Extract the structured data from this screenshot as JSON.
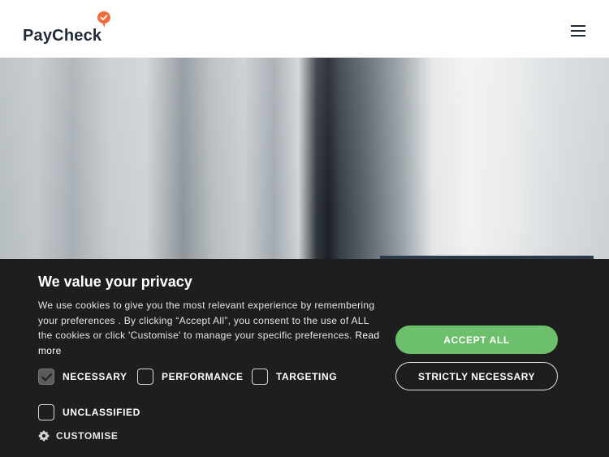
{
  "header": {
    "logo_text": "PayCheck",
    "logo_mark_color": "#f26b3a",
    "menu_icon": "hamburger-menu-icon"
  },
  "cookie_banner": {
    "title": "We value your privacy",
    "description": "We use cookies to give you the most relevant experience by remembering your preferences . By clicking “Accept All”, you consent to the use of ALL the cookies or click 'Customise' to manage your specific preferences.",
    "read_more": "Read more",
    "checkboxes": [
      {
        "label": "NECESSARY",
        "checked": true
      },
      {
        "label": "PERFORMANCE",
        "checked": false
      },
      {
        "label": "TARGETING",
        "checked": false
      },
      {
        "label": "UNCLASSIFIED",
        "checked": false
      }
    ],
    "customise_label": "CUSTOMISE",
    "customise_icon": "gear-icon",
    "accept_all_label": "ACCEPT ALL",
    "strictly_necessary_label": "STRICTLY NECESSARY",
    "colors": {
      "background": "#1e1e1e",
      "accept_button": "#6cc06c"
    }
  }
}
